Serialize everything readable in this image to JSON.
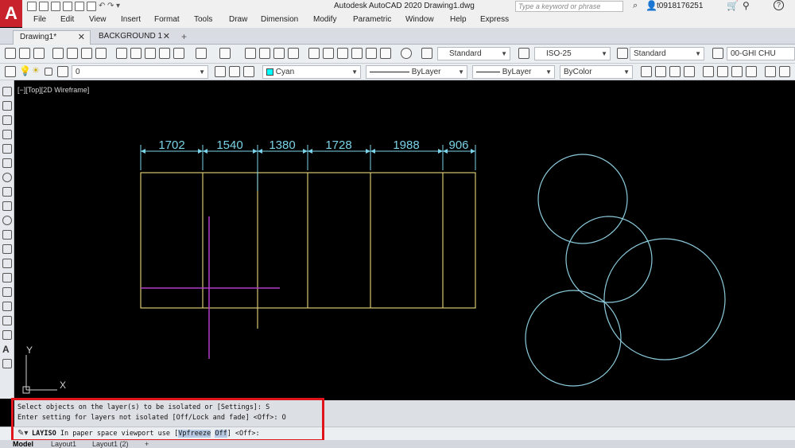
{
  "app": {
    "logo": "A",
    "title": "Autodesk AutoCAD 2020    Drawing1.dwg",
    "search_placeholder": "Type a keyword or phrase",
    "username": "t0918176251"
  },
  "menu": [
    "File",
    "Edit",
    "View",
    "Insert",
    "Format",
    "Tools",
    "Draw",
    "Dimension",
    "Modify",
    "Parametric",
    "Window",
    "Help",
    "Express"
  ],
  "tabs": [
    {
      "label": "Drawing1*"
    },
    {
      "label": "BACKGROUND 1"
    }
  ],
  "toolbar1": {
    "text_style": "Standard",
    "dim_style": "ISO-25",
    "table_style": "Standard",
    "multileader": "00-GHI CHU"
  },
  "toolbar2": {
    "layer": "0",
    "color": "Cyan",
    "linetype": "ByLayer",
    "lineweight": "ByLayer",
    "plotstyle": "ByColor"
  },
  "viewport_label": "[−][Top][2D Wireframe]",
  "dimensions": [
    "1702",
    "1540",
    "1380",
    "1728",
    "1988",
    "906"
  ],
  "ucs": {
    "x_label": "X",
    "y_label": "Y"
  },
  "command": {
    "history": [
      "Select objects on the layer(s) to be isolated or [Settings]: S",
      "Enter setting for layers not isolated [Off/Lock and fade] <Off>: O"
    ],
    "prompt_cmd": "LAYISO",
    "prompt_pre": " In paper space viewport use [",
    "prompt_opt1": "Vpfreeze",
    "prompt_opt2": "Off",
    "prompt_post": "] <Off>:"
  },
  "layout_tabs": [
    "Model",
    "Layout1",
    "Layout1 (2)"
  ],
  "colors": {
    "rect": "#d8c872",
    "dimension": "#7ad3e8",
    "circle": "#8ccbdc",
    "magenta_line": "#b03cc8",
    "highlight": "#e0141b"
  }
}
